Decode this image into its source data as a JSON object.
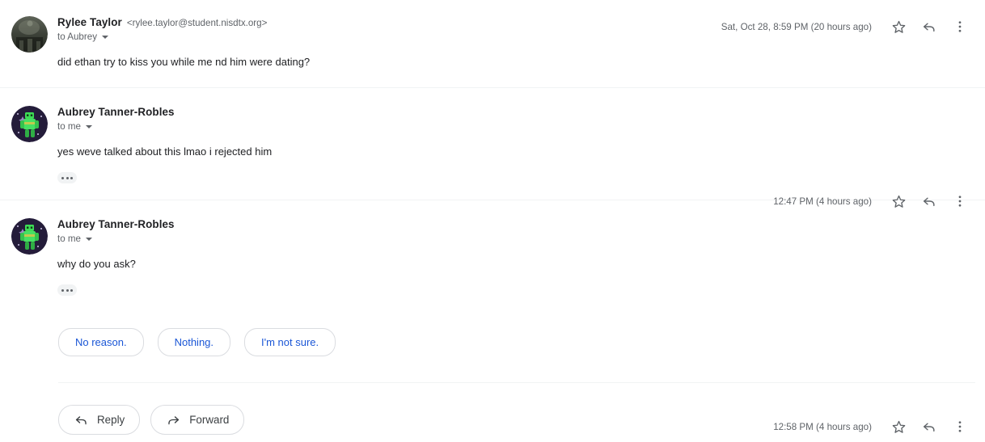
{
  "thread": {
    "messages": [
      {
        "sender": "Rylee Taylor",
        "email": "<rylee.taylor@student.nisdtx.org>",
        "recipient": "to Aubrey",
        "timestamp": "Sat, Oct 28, 8:59 PM (20 hours ago)",
        "body": "did ethan try to kiss you while me nd him were dating?",
        "avatar_type": "photo-dark",
        "has_trimmed": false
      },
      {
        "sender": "Aubrey Tanner-Robles",
        "email": "",
        "recipient": "to me",
        "timestamp": "12:47 PM (4 hours ago)",
        "body": "yes weve talked about this lmao i rejected him",
        "avatar_type": "photo-green",
        "has_trimmed": true
      },
      {
        "sender": "Aubrey Tanner-Robles",
        "email": "",
        "recipient": "to me",
        "timestamp": "12:58 PM (4 hours ago)",
        "body": "why do you ask?",
        "avatar_type": "photo-green",
        "has_trimmed": true
      }
    ]
  },
  "smart_replies": [
    {
      "label": "No reason."
    },
    {
      "label": "Nothing."
    },
    {
      "label": "I'm not sure."
    }
  ],
  "bottom_actions": [
    {
      "label": "Reply",
      "icon": "reply-arrow-icon"
    },
    {
      "label": "Forward",
      "icon": "forward-arrow-icon"
    }
  ],
  "icons": {
    "star": "star-icon",
    "reply": "reply-icon",
    "more": "more-vertical-icon",
    "trimmed": "show-trimmed-content-icon",
    "caret": "chevron-down-icon"
  },
  "colors": {
    "smart_reply_text": "#1a56d6",
    "divider": "#f1f3f4",
    "border": "#dadce0",
    "secondary_text": "#5f6368",
    "primary_text": "#202124"
  }
}
